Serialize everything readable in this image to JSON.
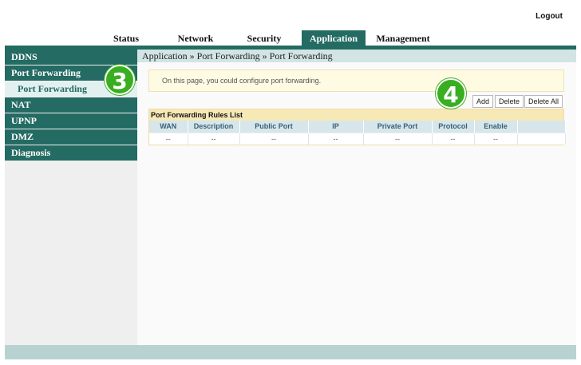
{
  "header": {
    "logout_label": "Logout"
  },
  "nav": {
    "tabs": [
      {
        "label": "Status"
      },
      {
        "label": "Network"
      },
      {
        "label": "Security"
      },
      {
        "label": "Application",
        "active": true
      },
      {
        "label": "Management"
      }
    ]
  },
  "sidebar": {
    "items": [
      {
        "label": "DDNS"
      },
      {
        "label": "Port Forwarding"
      },
      {
        "label": "Port Forwarding",
        "sub": true,
        "selected": true
      },
      {
        "label": "NAT"
      },
      {
        "label": "UPNP"
      },
      {
        "label": "DMZ"
      },
      {
        "label": "Diagnosis"
      }
    ]
  },
  "main": {
    "breadcrumb": "Application » Port Forwarding » Port Forwarding",
    "notice": "On this page, you could configure port forwarding.",
    "buttons": {
      "add": "Add",
      "delete": "Delete",
      "delete_all": "Delete All"
    },
    "table": {
      "title": "Port Forwarding Rules List",
      "columns": [
        "WAN",
        "Description",
        "Public Port",
        "IP",
        "Private Port",
        "Protocol",
        "Enable",
        ""
      ],
      "rows": [
        [
          "--",
          "--",
          "--",
          "--",
          "--",
          "--",
          "--",
          ""
        ]
      ]
    }
  },
  "annotations": {
    "step3": "3",
    "step4": "4"
  },
  "colors": {
    "primary": "#236b63",
    "badge": "#3aae21",
    "notice_bg": "#fffbe2",
    "table_header": "#d6e6ea"
  }
}
